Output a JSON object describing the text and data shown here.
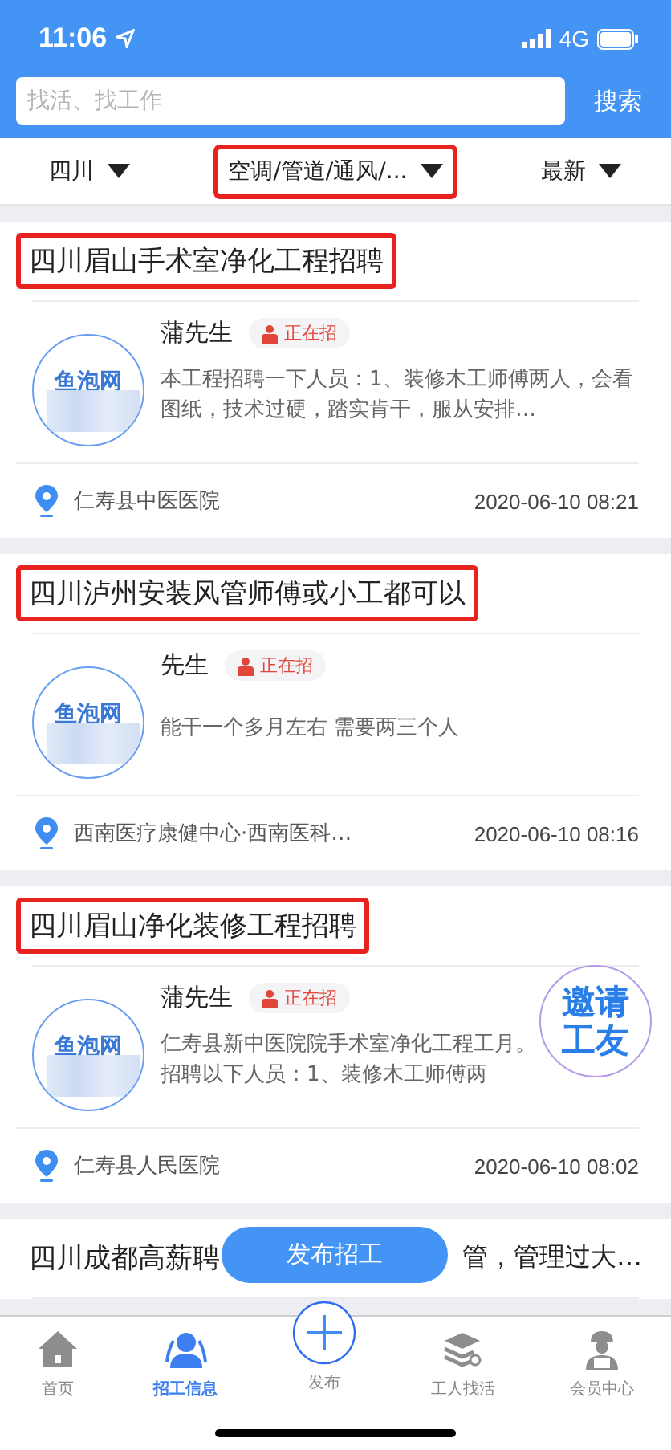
{
  "status_bar": {
    "time": "11:06",
    "network": "4G"
  },
  "search": {
    "placeholder": "找活、找工作",
    "button": "搜索"
  },
  "filters": [
    {
      "label": "四川",
      "highlighted": false
    },
    {
      "label": "空调/管道/通风/...",
      "highlighted": true
    },
    {
      "label": "最新",
      "highlighted": false
    }
  ],
  "cards": [
    {
      "title": "四川眉山手术室净化工程招聘",
      "highlighted": true,
      "avatar_text": "鱼泡网",
      "blurred": true,
      "contact": "蒲先生",
      "badge": "正在招",
      "description": "本工程招聘一下人员：1、装修木工师傅两人，会看图纸，技术过硬，踏实肯干，服从安排…",
      "location": "仁寿县中医医院",
      "time": "2020-06-10 08:21"
    },
    {
      "title": "四川泸州安装风管师傅或小工都可以",
      "highlighted": true,
      "avatar_text": "鱼泡网",
      "blurred": true,
      "contact": "先生",
      "badge": "正在招",
      "description": "能干一个多月左右 需要两三个人",
      "location": "西南医疗康健中心·西南医科…",
      "time": "2020-06-10 08:16"
    },
    {
      "title": "四川眉山净化装修工程招聘",
      "highlighted": true,
      "avatar_text": "鱼泡网",
      "blurred": true,
      "contact": "蒲先生",
      "badge": "正在招",
      "description": "仁寿县新中医院院手术室净化工程工月。招聘以下人员：1、装修木工师傅两",
      "location": "仁寿县人民医院",
      "time": "2020-06-10 08:02"
    },
    {
      "title": "四川成都高薪聘",
      "title_tail": "管，管理过大…",
      "highlighted": false
    }
  ],
  "invite_button": "邀请工友",
  "post_button": "发布招工",
  "tabs": [
    {
      "label": "首页",
      "kind": "home",
      "selected": false
    },
    {
      "label": "招工信息",
      "kind": "people",
      "selected": true
    },
    {
      "label": "发布",
      "kind": "plus",
      "selected": false
    },
    {
      "label": "工人找活",
      "kind": "stack",
      "selected": false
    },
    {
      "label": "会员中心",
      "kind": "worker",
      "selected": false
    }
  ]
}
